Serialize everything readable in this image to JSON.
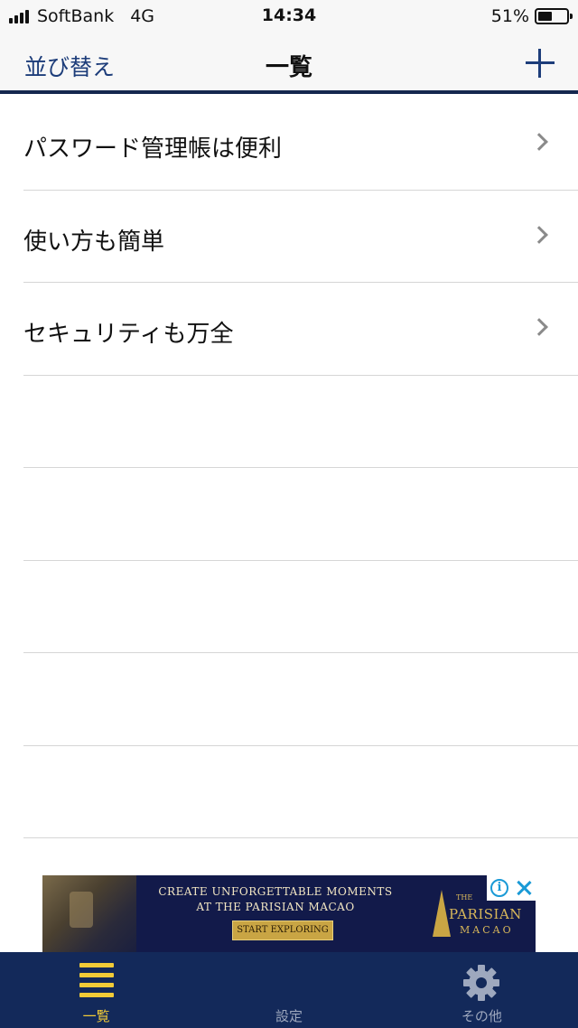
{
  "status_bar": {
    "carrier": "SoftBank",
    "network": "4G",
    "time": "14:34",
    "battery_percent": "51%",
    "battery_level": 0.51
  },
  "nav": {
    "sort_label": "並び替え",
    "title": "一覧",
    "add_icon": "plus-icon"
  },
  "list": {
    "items": [
      {
        "label": "パスワード管理帳は便利"
      },
      {
        "label": "使い方も簡単"
      },
      {
        "label": "セキュリティも万全"
      },
      {
        "label": ""
      },
      {
        "label": ""
      },
      {
        "label": ""
      },
      {
        "label": ""
      },
      {
        "label": ""
      }
    ]
  },
  "ad": {
    "headline_line1": "CREATE UNFORGETTABLE MOMENTS",
    "headline_line2": "AT THE PARISIAN MACAO",
    "cta": "START EXPLORING",
    "logo_the": "THE",
    "logo_name": "PARISIAN",
    "logo_city": "MACAO"
  },
  "tabs": [
    {
      "label": "一覧",
      "icon": "list-icon",
      "active": true
    },
    {
      "label": "設定",
      "icon": "gear-icon",
      "active": false
    },
    {
      "label": "その他",
      "icon": "more-dots-icon",
      "active": false
    }
  ],
  "colors": {
    "nav_accent": "#1d3d7a",
    "tab_bar_bg": "#13295a",
    "tab_active": "#f2cb37",
    "tab_inactive": "#9ea8be"
  }
}
